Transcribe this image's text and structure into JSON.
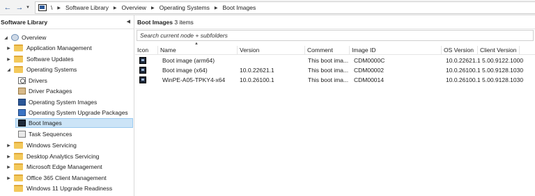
{
  "nav": {
    "back_icon": "back-arrow-icon",
    "forward_icon": "forward-arrow-icon",
    "breadcrumb": [
      "\\",
      "Software Library",
      "Overview",
      "Operating Systems",
      "Boot Images"
    ]
  },
  "left_pane": {
    "title": "Software Library",
    "tree": [
      {
        "label": "Overview",
        "icon": "overview-icon"
      },
      {
        "label": "Application Management",
        "icon": "folder-icon"
      },
      {
        "label": "Software Updates",
        "icon": "folder-icon"
      },
      {
        "label": "Operating Systems",
        "icon": "folder-icon"
      },
      {
        "label": "Drivers",
        "icon": "drivers-icon"
      },
      {
        "label": "Driver Packages",
        "icon": "package-icon"
      },
      {
        "label": "Operating System Images",
        "icon": "os-image-icon"
      },
      {
        "label": "Operating System Upgrade Packages",
        "icon": "upgrade-package-icon"
      },
      {
        "label": "Boot Images",
        "icon": "boot-image-icon"
      },
      {
        "label": "Task Sequences",
        "icon": "task-sequence-icon"
      },
      {
        "label": "Windows Servicing",
        "icon": "folder-icon"
      },
      {
        "label": "Desktop Analytics Servicing",
        "icon": "folder-icon"
      },
      {
        "label": "Microsoft Edge Management",
        "icon": "folder-icon"
      },
      {
        "label": "Office 365 Client Management",
        "icon": "folder-icon"
      },
      {
        "label": "Windows 11 Upgrade Readiness",
        "icon": "folder-icon"
      }
    ]
  },
  "right_pane": {
    "header_title": "Boot Images",
    "header_count": "3 items",
    "search_placeholder": "Search current node + subfolders",
    "columns": [
      "Icon",
      "Name",
      "Version",
      "Comment",
      "Image ID",
      "OS Version",
      "Client Version"
    ],
    "rows": [
      {
        "name": "Boot image (arm64)",
        "version": "",
        "comment": "This boot ima...",
        "image_id": "CDM0000C",
        "os_version": "10.0.22621.1",
        "client_version": "5.00.9122.1000"
      },
      {
        "name": "Boot image (x64)",
        "version": "10.0.22621.1",
        "comment": "This boot ima...",
        "image_id": "CDM00002",
        "os_version": "10.0.26100.1",
        "client_version": "5.00.9128.1030"
      },
      {
        "name": "WinPE-A05-TPKY4-x64",
        "version": "10.0.26100.1",
        "comment": "This boot ima...",
        "image_id": "CDM00014",
        "os_version": "10.0.26100.1",
        "client_version": "5.00.9128.1030"
      }
    ]
  },
  "colors": {
    "selection": "#cce4f7",
    "folder": "#f3c95c",
    "accent": "#2b5797"
  }
}
